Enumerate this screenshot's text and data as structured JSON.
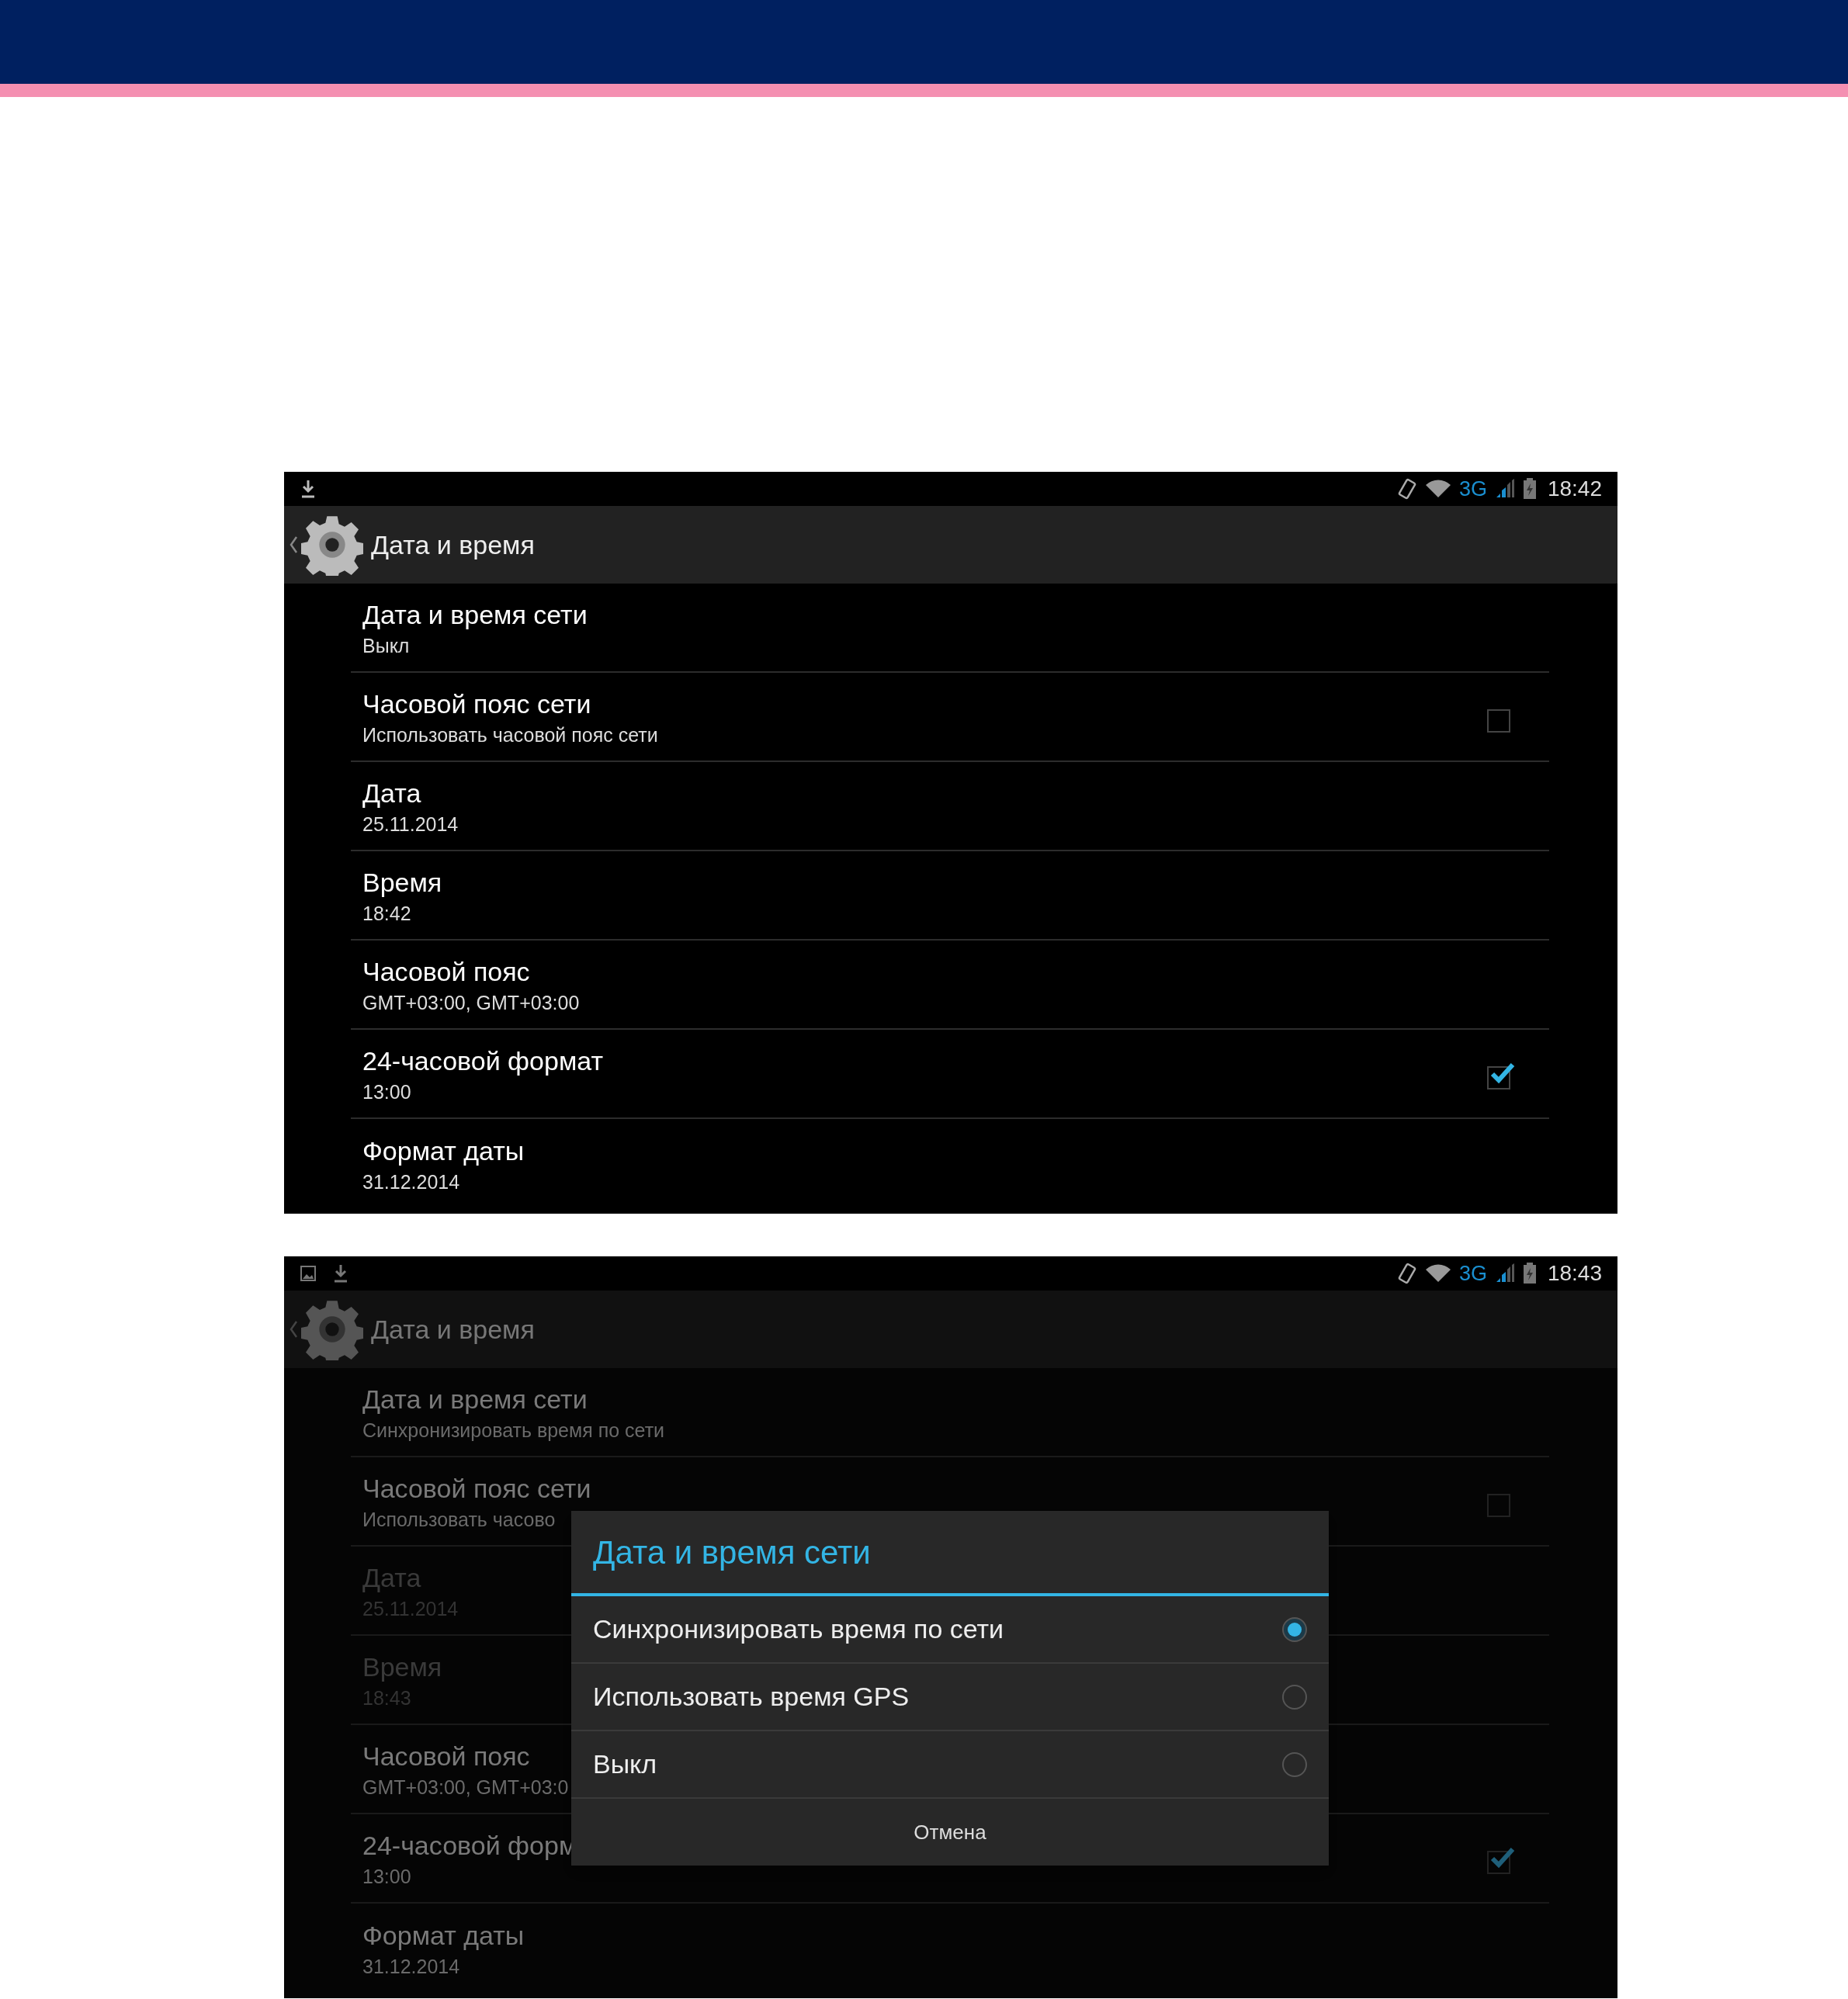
{
  "screens": [
    {
      "dimmed": false,
      "status_bar": {
        "notifications": [
          {
            "kind": "download"
          }
        ],
        "network": "3G",
        "time": "18:42"
      },
      "action_bar": {
        "title": "Дата и время"
      },
      "settings": [
        {
          "kind": "text",
          "title": "Дата и время сети",
          "summary": "Выкл",
          "disabled": false
        },
        {
          "kind": "checkbox",
          "title": "Часовой пояс сети",
          "summary": "Использовать часовой пояс сети",
          "checked": false,
          "disabled": false
        },
        {
          "kind": "text",
          "title": "Дата",
          "summary": "25.11.2014",
          "disabled": false
        },
        {
          "kind": "text",
          "title": "Время",
          "summary": "18:42",
          "disabled": false
        },
        {
          "kind": "text",
          "title": "Часовой пояс",
          "summary": "GMT+03:00, GMT+03:00",
          "disabled": false
        },
        {
          "kind": "checkbox",
          "title": "24-часовой формат",
          "summary": "13:00",
          "checked": true,
          "disabled": false
        },
        {
          "kind": "text",
          "title": "Формат даты",
          "summary": "31.12.2014",
          "disabled": false
        }
      ]
    },
    {
      "dimmed": true,
      "status_bar": {
        "notifications": [
          {
            "kind": "picture"
          },
          {
            "kind": "download"
          }
        ],
        "network": "3G",
        "time": "18:43"
      },
      "action_bar": {
        "title": "Дата и время"
      },
      "settings": [
        {
          "kind": "text",
          "title": "Дата и время сети",
          "summary": "Синхронизировать время по сети",
          "disabled": false
        },
        {
          "kind": "checkbox",
          "title": "Часовой пояс сети",
          "summary": "Использовать часово",
          "checked": false,
          "disabled": false
        },
        {
          "kind": "text",
          "title": "Дата",
          "summary": "25.11.2014",
          "disabled": true
        },
        {
          "kind": "text",
          "title": "Время",
          "summary": "18:43",
          "disabled": true
        },
        {
          "kind": "text",
          "title": "Часовой пояс",
          "summary": "GMT+03:00, GMT+03:0",
          "disabled": false
        },
        {
          "kind": "checkbox",
          "title": "24-часовой форм",
          "summary": "13:00",
          "checked": true,
          "disabled": false
        },
        {
          "kind": "text",
          "title": "Формат даты",
          "summary": "31.12.2014",
          "disabled": false
        }
      ],
      "dialog": {
        "title": "Дата и время сети",
        "options": [
          {
            "label": "Синхронизировать время по сети",
            "selected": true
          },
          {
            "label": "Использовать время GPS",
            "selected": false
          },
          {
            "label": "Выкл",
            "selected": false
          }
        ],
        "cancel": "Отмена"
      }
    }
  ]
}
